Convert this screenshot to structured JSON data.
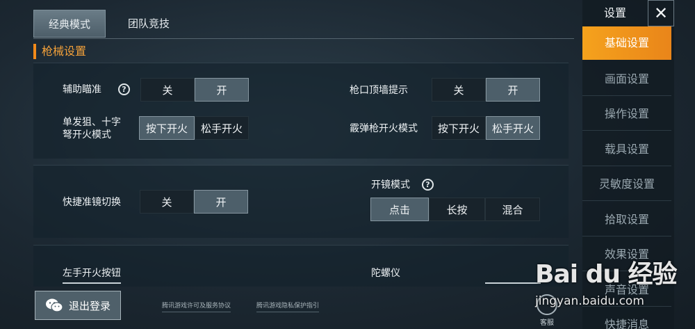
{
  "tabs": [
    "经典模式",
    "团队竞技"
  ],
  "section_title": "枪械设置",
  "panel1": {
    "aim_assist": {
      "label": "辅助瞄准",
      "options": [
        "关",
        "开"
      ],
      "selected": "开"
    },
    "muzzle_hint": {
      "label": "枪口顶墙提示",
      "options": [
        "关",
        "开"
      ],
      "selected": "开"
    },
    "sniper_fire": {
      "label_line1": "单发狙、十字",
      "label_line2": "弩开火模式",
      "options": [
        "按下开火",
        "松手开火"
      ],
      "selected": "按下开火"
    },
    "shotgun_fire": {
      "label": "霰弹枪开火模式",
      "options": [
        "按下开火",
        "松手开火"
      ],
      "selected": "松手开火"
    }
  },
  "panel2": {
    "quick_scope": {
      "label": "快捷准镜切换",
      "options": [
        "关",
        "开"
      ],
      "selected": "开"
    },
    "scope_mode": {
      "label": "开镜模式",
      "options": [
        "点击",
        "长按",
        "混合"
      ],
      "selected": "点击"
    }
  },
  "panel3": {
    "left_fire": {
      "label": "左手开火按钮"
    },
    "gyro": {
      "label": "陀螺仪"
    }
  },
  "footer": {
    "logout": "退出登录",
    "license": "腾讯游戏许可及服务协议",
    "privacy": "腾讯游戏隐私保护指引",
    "service": "客服"
  },
  "sidebar": {
    "title": "设置",
    "close": "✕",
    "items": [
      "基础设置",
      "画面设置",
      "操作设置",
      "载具设置",
      "灵敏度设置",
      "拾取设置",
      "效果设置",
      "声音设置",
      "快捷消息"
    ],
    "active": "基础设置"
  },
  "watermark": {
    "main": "Bai du 经验",
    "url": "jingyan.baidu.com"
  },
  "colors": {
    "accent": "#f28a1a",
    "selected_option": "#4d5f6a"
  }
}
